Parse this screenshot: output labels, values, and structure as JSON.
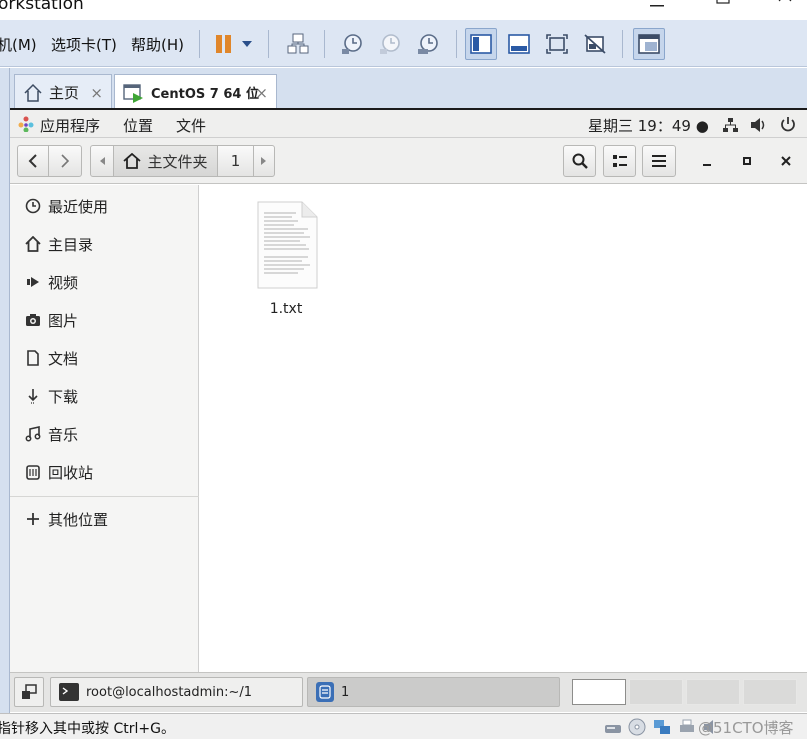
{
  "window": {
    "title": "orkstation",
    "controls": [
      "minimize-icon",
      "maximize-icon",
      "close-icon"
    ]
  },
  "vm_menu": [
    "机(M)",
    "选项卡(T)",
    "帮助(H)"
  ],
  "vm_toolbar": {
    "icons": [
      "pause-icon",
      "dropdown-arrow-icon",
      "network-icon",
      "snapshot-icon",
      "snapshot-revert-icon",
      "snapshot-manager-icon",
      "view-console-icon",
      "view-thumbnail-icon",
      "fullscreen-icon",
      "unity-icon",
      "library-icon"
    ]
  },
  "vm_tabs": [
    {
      "label": "主页",
      "icon": "home-icon",
      "close": "×"
    },
    {
      "label": "CentOS 7 64 位",
      "icon": "vm-running-icon",
      "close": "×"
    }
  ],
  "gnome_top": {
    "apps": "应用程序",
    "places": "位置",
    "files": "文件",
    "clock": "星期三 19：49 ●"
  },
  "nautilus": {
    "path_home": "主文件夹",
    "path_current": "1"
  },
  "sidebar": {
    "items": [
      {
        "label": "最近使用",
        "icon": "clock-icon"
      },
      {
        "label": "主目录",
        "icon": "home-icon"
      },
      {
        "label": "视频",
        "icon": "video-icon"
      },
      {
        "label": "图片",
        "icon": "camera-icon"
      },
      {
        "label": "文档",
        "icon": "document-icon"
      },
      {
        "label": "下载",
        "icon": "download-icon"
      },
      {
        "label": "音乐",
        "icon": "music-icon"
      },
      {
        "label": "回收站",
        "icon": "trash-icon"
      }
    ],
    "other_locations": "其他位置"
  },
  "files": [
    {
      "name": "1.txt",
      "icon": "text-file-icon"
    }
  ],
  "taskbar": {
    "terminal": "root@localhostadmin:~/1",
    "files_window": "1"
  },
  "status_bar": {
    "message": "指针移入其中或按 Ctrl+G。",
    "watermark": "@51CTO博客"
  }
}
